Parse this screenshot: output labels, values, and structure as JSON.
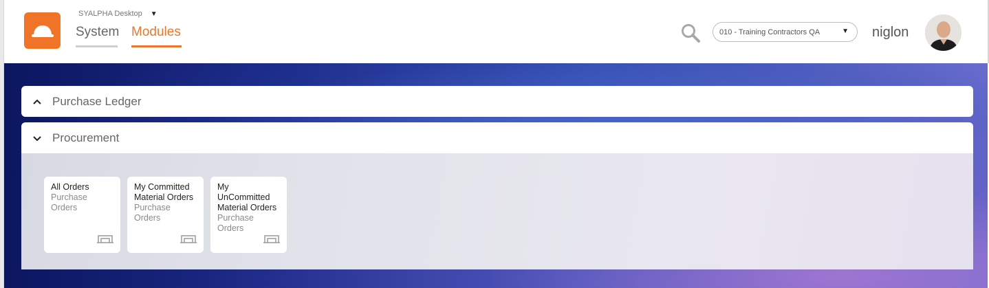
{
  "header": {
    "app_picker_label": "SYALPHA Desktop",
    "nav": [
      {
        "label": "System",
        "active": false
      },
      {
        "label": "Modules",
        "active": true
      }
    ],
    "company_select_value": "010 - Training Contractors QA",
    "username": "niglon",
    "accent_color": "#f07427"
  },
  "sections": [
    {
      "title": "Purchase Ledger",
      "expanded": false,
      "icon": "chevron-up-icon"
    },
    {
      "title": "Procurement",
      "expanded": true,
      "icon": "chevron-down-icon"
    }
  ],
  "tiles": [
    {
      "title": "All Orders",
      "subtitle": "Purchase Orders",
      "icon": "module-icon"
    },
    {
      "title": "My Committed Material Orders",
      "subtitle": "Purchase Orders",
      "icon": "module-icon"
    },
    {
      "title": "My UnCommitted Material Orders",
      "subtitle": "Purchase Orders",
      "icon": "module-icon"
    }
  ]
}
